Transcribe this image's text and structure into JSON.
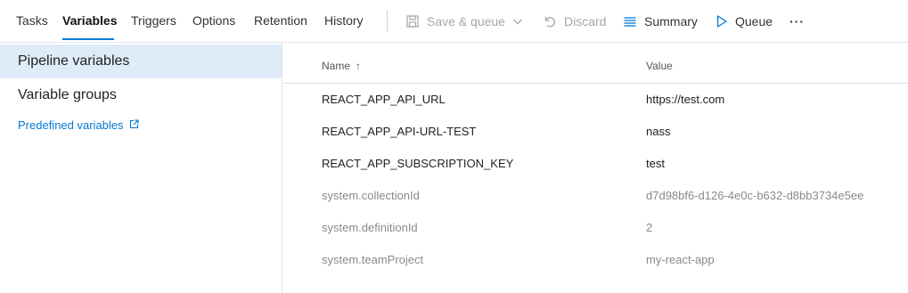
{
  "tabs": [
    {
      "label": "Tasks"
    },
    {
      "label": "Variables"
    },
    {
      "label": "Triggers"
    },
    {
      "label": "Options"
    },
    {
      "label": "Retention"
    },
    {
      "label": "History"
    }
  ],
  "active_tab": "Variables",
  "actions": {
    "save_queue": "Save & queue",
    "discard": "Discard",
    "summary": "Summary",
    "queue": "Queue",
    "more": "···"
  },
  "left_panel": {
    "pipeline_variables": "Pipeline variables",
    "variable_groups": "Variable groups",
    "predefined_variables": "Predefined variables"
  },
  "grid": {
    "name_header": "Name",
    "name_sort": "↑",
    "value_header": "Value",
    "rows": [
      {
        "name": "REACT_APP_API_URL",
        "value": "https://test.com",
        "kind": "user"
      },
      {
        "name": "REACT_APP_API-URL-TEST",
        "value": "nass",
        "kind": "user"
      },
      {
        "name": "REACT_APP_SUBSCRIPTION_KEY",
        "value": "test",
        "kind": "user"
      },
      {
        "name": "system.collectionId",
        "value": "d7d98bf6-d126-4e0c-b632-d8bb3734e5ee",
        "kind": "system"
      },
      {
        "name": "system.definitionId",
        "value": "2",
        "kind": "system"
      },
      {
        "name": "system.teamProject",
        "value": "my-react-app",
        "kind": "system"
      }
    ]
  },
  "colors": {
    "accent": "#0078d4",
    "selected_bg": "#deecf9",
    "system_text": "#8a8a8a",
    "disabled_text": "#a6a6a6"
  }
}
